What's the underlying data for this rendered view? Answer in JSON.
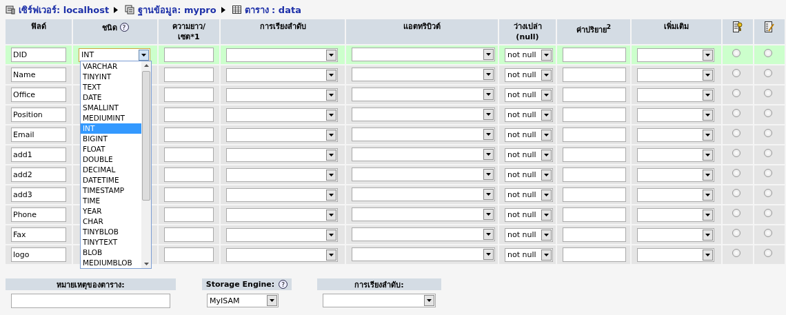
{
  "breadcrumb": [
    {
      "kind": "server",
      "label": "เซิร์ฟเวอร์: localhost"
    },
    {
      "kind": "database",
      "label": "ฐานข้อมูล: mypro"
    },
    {
      "kind": "table",
      "label": "ตาราง : data"
    }
  ],
  "columns": [
    {
      "kind": "text",
      "label": "ฟิลด์"
    },
    {
      "kind": "help",
      "label": "ชนิด",
      "help": "?"
    },
    {
      "kind": "text",
      "label": "ความยาว/\nเซต*1"
    },
    {
      "kind": "text",
      "label": "การเรียงลำดับ"
    },
    {
      "kind": "text",
      "label": "แอตทริบิวต์"
    },
    {
      "kind": "text",
      "label": "ว่างเปล่า\n(null)"
    },
    {
      "kind": "text",
      "label": "ค่าปริยาย$^{2}$"
    },
    {
      "kind": "text",
      "label": "เพิ่มเติม"
    },
    {
      "kind": "key-icon"
    },
    {
      "kind": "index-icon"
    }
  ],
  "rows": [
    {
      "field": "DID",
      "type": "INT",
      "null": "not null",
      "highlighted": true,
      "primary": false,
      "index": false
    },
    {
      "field": "Name",
      "null": "not null",
      "highlighted": false,
      "primary": false,
      "index": false
    },
    {
      "field": "Office",
      "null": "not null",
      "highlighted": false,
      "primary": false,
      "index": false
    },
    {
      "field": "Position",
      "null": "not null",
      "highlighted": false,
      "primary": false,
      "index": false
    },
    {
      "field": "Email",
      "null": "not null",
      "highlighted": false,
      "primary": false,
      "index": false
    },
    {
      "field": "add1",
      "null": "not null",
      "highlighted": false,
      "primary": false,
      "index": false
    },
    {
      "field": "add2",
      "null": "not null",
      "highlighted": false,
      "primary": false,
      "index": false
    },
    {
      "field": "add3",
      "null": "not null",
      "highlighted": false,
      "primary": false,
      "index": false
    },
    {
      "field": "Phone",
      "null": "not null",
      "highlighted": false,
      "primary": false,
      "index": false
    },
    {
      "field": "Fax",
      "null": "not null",
      "highlighted": false,
      "primary": false,
      "index": false
    },
    {
      "field": "logo",
      "null": "not null",
      "highlighted": false,
      "primary": false,
      "index": false
    }
  ],
  "type_dropdown": [
    {
      "label": "VARCHAR",
      "selected": false
    },
    {
      "label": "TINYINT",
      "selected": false
    },
    {
      "label": "TEXT",
      "selected": false
    },
    {
      "label": "DATE",
      "selected": false
    },
    {
      "label": "SMALLINT",
      "selected": false
    },
    {
      "label": "MEDIUMINT",
      "selected": false
    },
    {
      "label": "INT",
      "selected": true
    },
    {
      "label": "BIGINT",
      "selected": false
    },
    {
      "label": "FLOAT",
      "selected": false
    },
    {
      "label": "DOUBLE",
      "selected": false
    },
    {
      "label": "DECIMAL",
      "selected": false
    },
    {
      "label": "DATETIME",
      "selected": false
    },
    {
      "label": "TIMESTAMP",
      "selected": false
    },
    {
      "label": "TIME",
      "selected": false
    },
    {
      "label": "YEAR",
      "selected": false
    },
    {
      "label": "CHAR",
      "selected": false
    },
    {
      "label": "TINYBLOB",
      "selected": false
    },
    {
      "label": "TINYTEXT",
      "selected": false
    },
    {
      "label": "BLOB",
      "selected": false
    },
    {
      "label": "MEDIUMBLOB",
      "selected": false
    }
  ],
  "footer": {
    "comment_label": "หมายเหตุของตาราง:",
    "engine_label": "Storage Engine:",
    "engine_help": "?",
    "engine_value": "MyISAM",
    "collation_label": "การเรียงลำดับ:"
  }
}
